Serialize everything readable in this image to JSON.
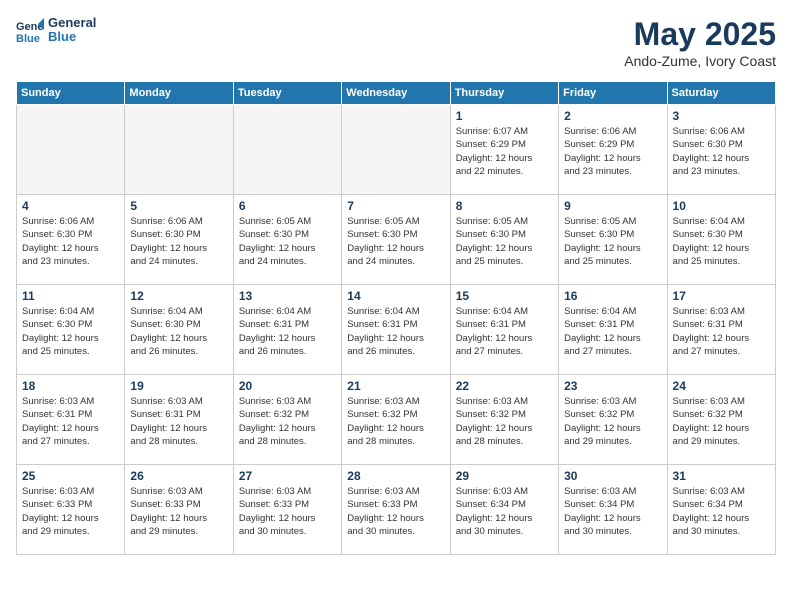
{
  "header": {
    "logo_line1": "General",
    "logo_line2": "Blue",
    "month_year": "May 2025",
    "location": "Ando-Zume, Ivory Coast"
  },
  "weekdays": [
    "Sunday",
    "Monday",
    "Tuesday",
    "Wednesday",
    "Thursday",
    "Friday",
    "Saturday"
  ],
  "weeks": [
    [
      {
        "day": "",
        "info": ""
      },
      {
        "day": "",
        "info": ""
      },
      {
        "day": "",
        "info": ""
      },
      {
        "day": "",
        "info": ""
      },
      {
        "day": "1",
        "info": "Sunrise: 6:07 AM\nSunset: 6:29 PM\nDaylight: 12 hours\nand 22 minutes."
      },
      {
        "day": "2",
        "info": "Sunrise: 6:06 AM\nSunset: 6:29 PM\nDaylight: 12 hours\nand 23 minutes."
      },
      {
        "day": "3",
        "info": "Sunrise: 6:06 AM\nSunset: 6:30 PM\nDaylight: 12 hours\nand 23 minutes."
      }
    ],
    [
      {
        "day": "4",
        "info": "Sunrise: 6:06 AM\nSunset: 6:30 PM\nDaylight: 12 hours\nand 23 minutes."
      },
      {
        "day": "5",
        "info": "Sunrise: 6:06 AM\nSunset: 6:30 PM\nDaylight: 12 hours\nand 24 minutes."
      },
      {
        "day": "6",
        "info": "Sunrise: 6:05 AM\nSunset: 6:30 PM\nDaylight: 12 hours\nand 24 minutes."
      },
      {
        "day": "7",
        "info": "Sunrise: 6:05 AM\nSunset: 6:30 PM\nDaylight: 12 hours\nand 24 minutes."
      },
      {
        "day": "8",
        "info": "Sunrise: 6:05 AM\nSunset: 6:30 PM\nDaylight: 12 hours\nand 25 minutes."
      },
      {
        "day": "9",
        "info": "Sunrise: 6:05 AM\nSunset: 6:30 PM\nDaylight: 12 hours\nand 25 minutes."
      },
      {
        "day": "10",
        "info": "Sunrise: 6:04 AM\nSunset: 6:30 PM\nDaylight: 12 hours\nand 25 minutes."
      }
    ],
    [
      {
        "day": "11",
        "info": "Sunrise: 6:04 AM\nSunset: 6:30 PM\nDaylight: 12 hours\nand 25 minutes."
      },
      {
        "day": "12",
        "info": "Sunrise: 6:04 AM\nSunset: 6:30 PM\nDaylight: 12 hours\nand 26 minutes."
      },
      {
        "day": "13",
        "info": "Sunrise: 6:04 AM\nSunset: 6:31 PM\nDaylight: 12 hours\nand 26 minutes."
      },
      {
        "day": "14",
        "info": "Sunrise: 6:04 AM\nSunset: 6:31 PM\nDaylight: 12 hours\nand 26 minutes."
      },
      {
        "day": "15",
        "info": "Sunrise: 6:04 AM\nSunset: 6:31 PM\nDaylight: 12 hours\nand 27 minutes."
      },
      {
        "day": "16",
        "info": "Sunrise: 6:04 AM\nSunset: 6:31 PM\nDaylight: 12 hours\nand 27 minutes."
      },
      {
        "day": "17",
        "info": "Sunrise: 6:03 AM\nSunset: 6:31 PM\nDaylight: 12 hours\nand 27 minutes."
      }
    ],
    [
      {
        "day": "18",
        "info": "Sunrise: 6:03 AM\nSunset: 6:31 PM\nDaylight: 12 hours\nand 27 minutes."
      },
      {
        "day": "19",
        "info": "Sunrise: 6:03 AM\nSunset: 6:31 PM\nDaylight: 12 hours\nand 28 minutes."
      },
      {
        "day": "20",
        "info": "Sunrise: 6:03 AM\nSunset: 6:32 PM\nDaylight: 12 hours\nand 28 minutes."
      },
      {
        "day": "21",
        "info": "Sunrise: 6:03 AM\nSunset: 6:32 PM\nDaylight: 12 hours\nand 28 minutes."
      },
      {
        "day": "22",
        "info": "Sunrise: 6:03 AM\nSunset: 6:32 PM\nDaylight: 12 hours\nand 28 minutes."
      },
      {
        "day": "23",
        "info": "Sunrise: 6:03 AM\nSunset: 6:32 PM\nDaylight: 12 hours\nand 29 minutes."
      },
      {
        "day": "24",
        "info": "Sunrise: 6:03 AM\nSunset: 6:32 PM\nDaylight: 12 hours\nand 29 minutes."
      }
    ],
    [
      {
        "day": "25",
        "info": "Sunrise: 6:03 AM\nSunset: 6:33 PM\nDaylight: 12 hours\nand 29 minutes."
      },
      {
        "day": "26",
        "info": "Sunrise: 6:03 AM\nSunset: 6:33 PM\nDaylight: 12 hours\nand 29 minutes."
      },
      {
        "day": "27",
        "info": "Sunrise: 6:03 AM\nSunset: 6:33 PM\nDaylight: 12 hours\nand 30 minutes."
      },
      {
        "day": "28",
        "info": "Sunrise: 6:03 AM\nSunset: 6:33 PM\nDaylight: 12 hours\nand 30 minutes."
      },
      {
        "day": "29",
        "info": "Sunrise: 6:03 AM\nSunset: 6:34 PM\nDaylight: 12 hours\nand 30 minutes."
      },
      {
        "day": "30",
        "info": "Sunrise: 6:03 AM\nSunset: 6:34 PM\nDaylight: 12 hours\nand 30 minutes."
      },
      {
        "day": "31",
        "info": "Sunrise: 6:03 AM\nSunset: 6:34 PM\nDaylight: 12 hours\nand 30 minutes."
      }
    ]
  ]
}
